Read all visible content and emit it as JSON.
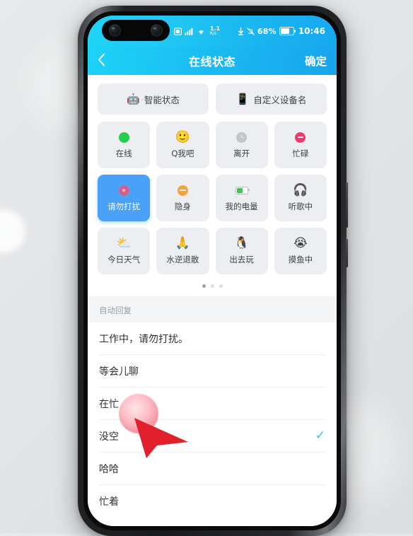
{
  "statusbar": {
    "network_speed_value": "1.1",
    "network_speed_unit": "K/s",
    "battery_percent": "68%",
    "clock": "10:46",
    "icons": [
      "sim-card-icon",
      "signal-bars-icon",
      "wifi-icon",
      "download-arrow-icon",
      "mute-bell-icon",
      "battery-icon"
    ]
  },
  "navbar": {
    "back_icon": "chevron-left-icon",
    "title": "在线状态",
    "confirm_label": "确定"
  },
  "top_actions": [
    {
      "icon": "robot-icon",
      "glyph": "🤖",
      "label": "智能状态"
    },
    {
      "icon": "phone-device-icon",
      "glyph": "📱",
      "label": "自定义设备名"
    }
  ],
  "status_grid": [
    {
      "label": "在线",
      "icon": "green-dot-icon",
      "selected": false
    },
    {
      "label": "Q我吧",
      "icon": "smiley-face-icon",
      "selected": false,
      "glyph": "🙂"
    },
    {
      "label": "离开",
      "icon": "gray-clock-icon",
      "selected": false
    },
    {
      "label": "忙碌",
      "icon": "busy-minus-icon",
      "selected": false
    },
    {
      "label": "请勿打扰",
      "icon": "do-not-disturb-icon",
      "selected": true
    },
    {
      "label": "隐身",
      "icon": "invisible-icon",
      "selected": false
    },
    {
      "label": "我的电量",
      "icon": "battery-level-icon",
      "selected": false
    },
    {
      "label": "听歌中",
      "icon": "headphones-face-icon",
      "selected": false,
      "glyph": "🎧"
    },
    {
      "label": "今日天气",
      "icon": "sun-cloud-icon",
      "selected": false,
      "glyph": "⛅"
    },
    {
      "label": "水逆退散",
      "icon": "praying-hands-icon",
      "selected": false,
      "glyph": "🙏"
    },
    {
      "label": "出去玩",
      "icon": "penguin-icon",
      "selected": false,
      "glyph": "🐧"
    },
    {
      "label": "摸鱼中",
      "icon": "sweat-face-icon",
      "selected": false,
      "glyph": "😭"
    }
  ],
  "pager": {
    "total": 3,
    "active_index": 0
  },
  "section": {
    "auto_reply_title": "自动回复"
  },
  "auto_replies": [
    {
      "text": "工作中，请勿打扰。",
      "selected": false
    },
    {
      "text": "等会儿聊",
      "selected": false
    },
    {
      "text": "在忙",
      "selected": false
    },
    {
      "text": "没空",
      "selected": true
    },
    {
      "text": "哈哈",
      "selected": false
    },
    {
      "text": "忙着",
      "selected": false
    }
  ],
  "check_glyph": "✓",
  "colors": {
    "header_start": "#1dd3f6",
    "header_end": "#18a5ed",
    "selected_card": "#4ba0f7",
    "card": "#eceef1",
    "check": "#2ec7e8",
    "cursor": "#e2202c",
    "page_bg": "#e3e5e7"
  },
  "cursor": {
    "name": "mouse-pointer",
    "tap_highlight": true
  }
}
